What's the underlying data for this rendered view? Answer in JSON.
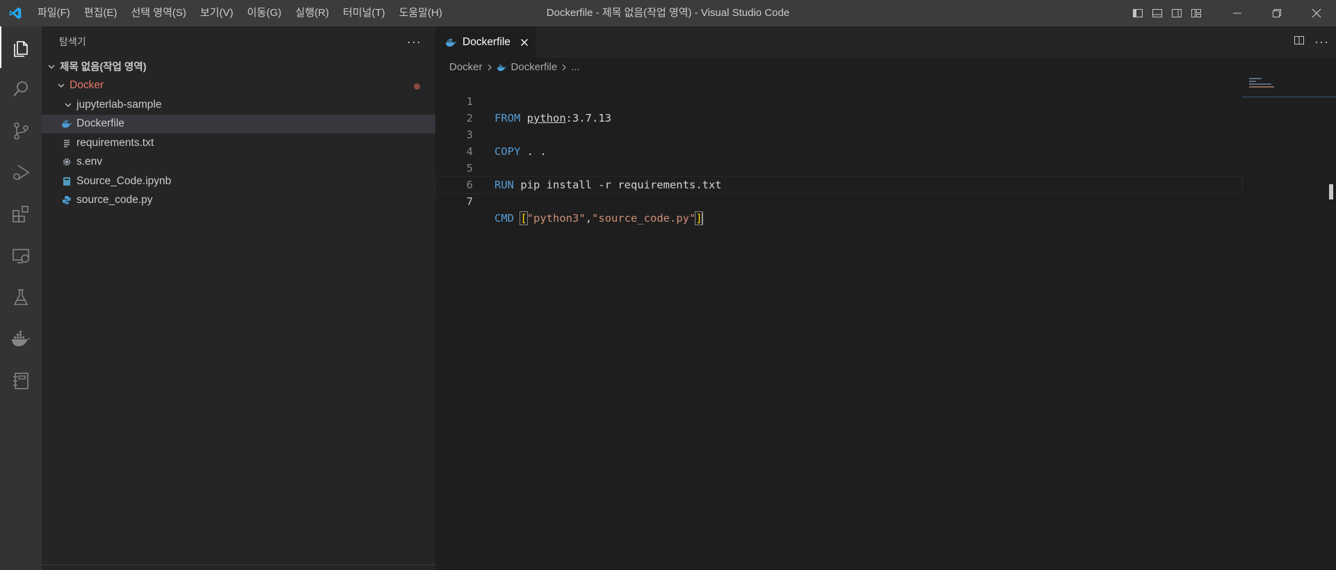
{
  "window": {
    "title": "Dockerfile - 제목 없음(작업 영역) - Visual Studio Code"
  },
  "menu": [
    "파일(F)",
    "편집(E)",
    "선택 영역(S)",
    "보기(V)",
    "이동(G)",
    "실행(R)",
    "터미널(T)",
    "도움말(H)"
  ],
  "activity_bar": [
    "files-icon",
    "search-icon",
    "source-control-icon",
    "run-debug-icon",
    "extensions-icon",
    "remote-explorer-icon",
    "testing-icon",
    "docker-icon",
    "notebook-icon"
  ],
  "sidebar": {
    "title": "탐색기",
    "workspace": "제목 없음(작업 영역)",
    "folder": "Docker",
    "items": [
      {
        "label": "jupyterlab-sample",
        "kind": "folder"
      },
      {
        "label": "Dockerfile",
        "kind": "docker",
        "selected": true
      },
      {
        "label": "requirements.txt",
        "kind": "text"
      },
      {
        "label": "s.env",
        "kind": "gear"
      },
      {
        "label": "Source_Code.ipynb",
        "kind": "notebook"
      },
      {
        "label": "source_code.py",
        "kind": "python"
      }
    ]
  },
  "editor": {
    "tab": "Dockerfile",
    "breadcrumbs": [
      "Docker",
      "Dockerfile",
      "..."
    ],
    "active_line": 7,
    "lines": [
      {
        "n": "1",
        "kw": "FROM",
        "rest": "python",
        "rest2": ":3.7.13"
      },
      {
        "n": "2"
      },
      {
        "n": "3",
        "kw": "COPY",
        "rest": " . ."
      },
      {
        "n": "4"
      },
      {
        "n": "5",
        "kw": "RUN",
        "rest": " pip install -r requirements.txt"
      },
      {
        "n": "6"
      },
      {
        "n": "7",
        "kw": "CMD",
        "open": "[",
        "s1": "\"python3\"",
        "comma": ",",
        "s2": "\"source_code.py\"",
        "close": "]"
      }
    ]
  },
  "colors": {
    "keyword": "#569cd6",
    "string": "#ce9178",
    "folder_modified": "#e9776a",
    "accent_vscode": "#23a9f2"
  }
}
